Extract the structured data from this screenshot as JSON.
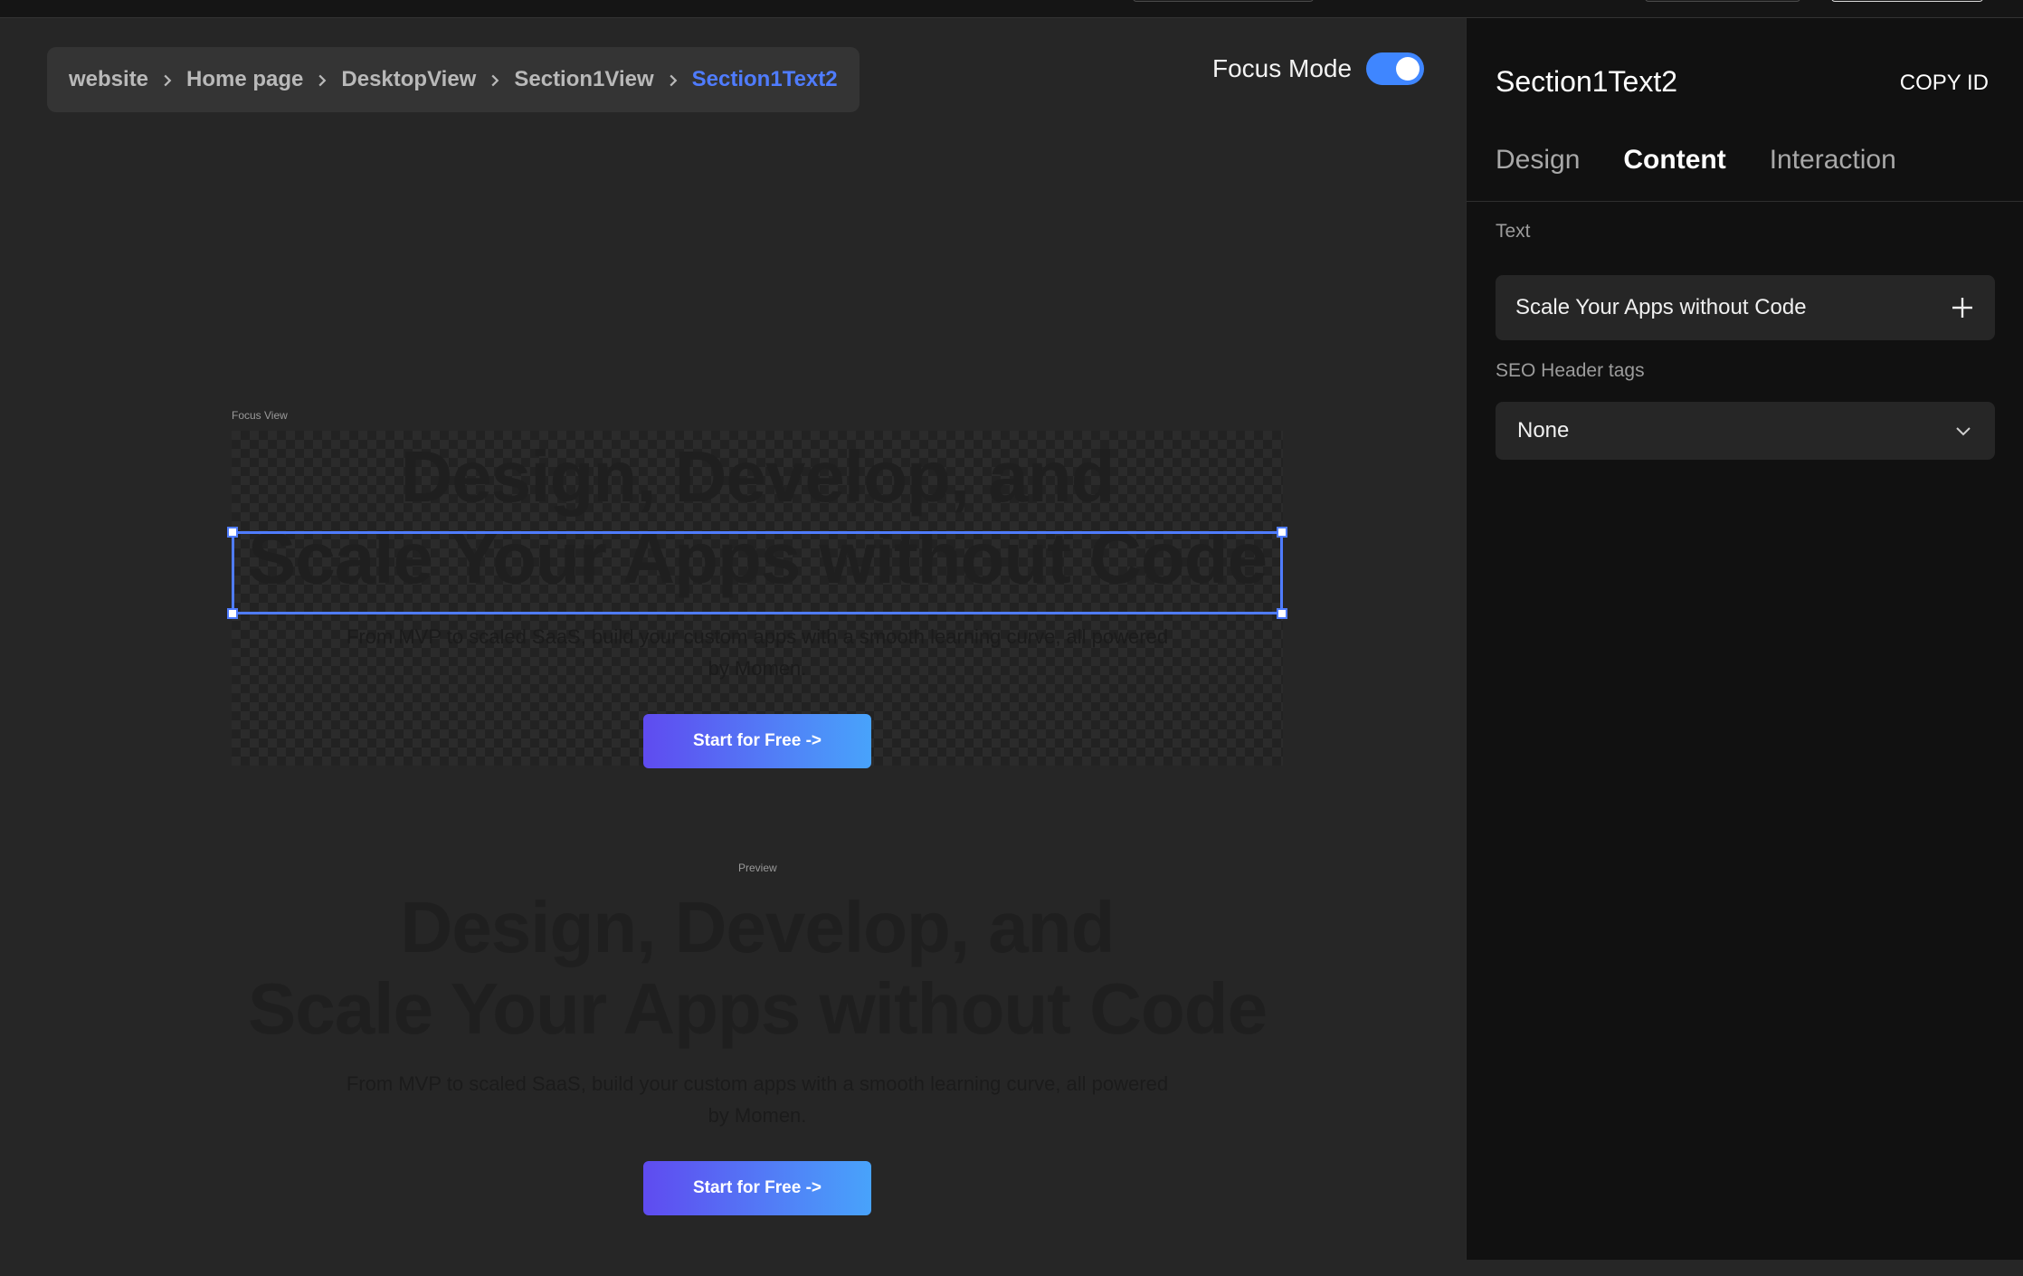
{
  "breadcrumb": {
    "items": [
      "website",
      "Home page",
      "DesktopView",
      "Section1View",
      "Section1Text2"
    ]
  },
  "focus_mode": {
    "label": "Focus Mode",
    "enabled": true
  },
  "canvas": {
    "focus_label": "Focus View",
    "preview_label": "Preview",
    "hero": {
      "title_line1": "Design, Develop, and",
      "title_line2": "Scale Your Apps without Code",
      "subtitle_line1": "From MVP to scaled SaaS, build your custom apps with a smooth learning curve, all powered",
      "subtitle_line2": "by Momen.",
      "button_label": "Start for Free ->"
    }
  },
  "panel": {
    "title": "Section1Text2",
    "copy_id_label": "COPY ID",
    "tabs": [
      {
        "label": "Design",
        "active": false
      },
      {
        "label": "Content",
        "active": true
      },
      {
        "label": "Interaction",
        "active": false
      }
    ],
    "text_label": "Text",
    "text_value": "Scale Your Apps without Code",
    "seo_label": "SEO Header tags",
    "seo_value": "None"
  },
  "colors": {
    "accent": "#4f7cff",
    "toggle_on": "#3f86ff",
    "button_gradient_start": "#5f4bf0",
    "button_gradient_end": "#48a3fb"
  },
  "icons": {
    "breadcrumb_separator": "chevron-right-icon",
    "add": "plus-icon",
    "dropdown": "chevron-down-icon"
  }
}
